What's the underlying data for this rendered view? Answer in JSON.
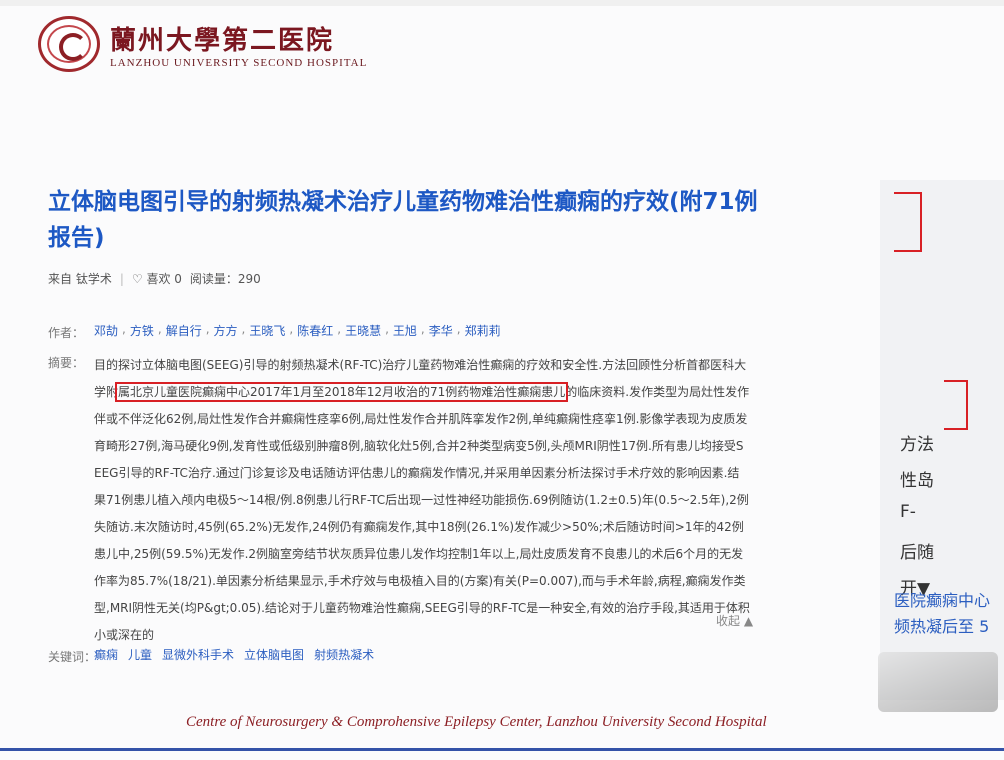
{
  "header": {
    "logo_cn": "蘭州大學第二医院",
    "logo_en": "LANZHOU UNIVERSITY SECOND HOSPITAL"
  },
  "article": {
    "title": "立体脑电图引导的射频热凝术治疗儿童药物难治性癫痫的疗效(附71例报告)",
    "source": "来自 钛学术",
    "likes": "♡ 喜欢 0",
    "reads": "阅读量：290",
    "authors_label": "作者：",
    "authors": [
      "邓劼",
      "方铁",
      "解自行",
      "方方",
      "王晓飞",
      "陈春红",
      "王晓慧",
      "王旭",
      "李华",
      "郑莉莉"
    ],
    "abstract_label": "摘要：",
    "abstract_pre": "目的探讨立体脑电图(SEEG)引导的射频热凝术(RF-TC)治疗儿童药物难治性癫痫的疗效和安全性.方法回顾性分析首都医科大学附",
    "abstract_highlight": "属北京儿童医院癫痫中心2017年1月至2018年12月收治的71例药物难治性癫痫患儿",
    "abstract_post": "的临床资料.发作类型为局灶性发作伴或不伴泛化62例,局灶性发作合并癫痫性痉挛6例,局灶性发作合并肌阵挛发作2例,单纯癫痫性痉挛1例.影像学表现为皮质发育畸形27例,海马硬化9例,发育性或低级别肿瘤8例,脑软化灶5例,合并2种类型病变5例,头颅MRI阴性17例.所有患儿均接受SEEG引导的RF-TC治疗.通过门诊复诊及电话随访评估患儿的癫痫发作情况,并采用单因素分析法探讨手术疗效的影响因素.结果71例患儿植入颅内电极5～14根/例.8例患儿行RF-TC后出现一过性神经功能损伤.69例随访(1.2±0.5)年(0.5～2.5年),2例失随访.末次随访时,45例(65.2%)无发作,24例仍有癫痫发作,其中18例(26.1%)发作减少>50%;术后随访时间>1年的42例患儿中,25例(59.5%)无发作.2例脑室旁结节状灰质异位患儿发作均控制1年以上,局灶皮质发育不良患儿的术后6个月的无发作率为85.7%(18/21).单因素分析结果显示,手术疗效与电极植入目的(方案)有关(P=0.007),而与手术年龄,病程,癫痫发作类型,MRI阴性无关(均P&gt;0.05).结论对于儿童药物难治性癫痫,SEEG引导的RF-TC是一种安全,有效的治疗手段,其适用于体积小或深在的",
    "collapse_label": "收起",
    "keywords_label": "关键词：",
    "keywords": [
      "癫痫",
      "儿童",
      "显微外科手术",
      "立体脑电图",
      "射频热凝术"
    ]
  },
  "right_panel": {
    "lines": [
      "方法",
      "性岛",
      "F-",
      "后随",
      "开▼"
    ],
    "link": "医院癫痫中心 频热凝后至 5"
  },
  "footer": {
    "text": "Centre of Neurosurgery & Comprohensive Epilepsy Center, Lanzhou University Second Hospital"
  },
  "colors": {
    "title_blue": "#1d58c4",
    "highlight_red": "#d82025",
    "brand_red": "#8c1f24",
    "footer_blue": "#3452a8"
  }
}
